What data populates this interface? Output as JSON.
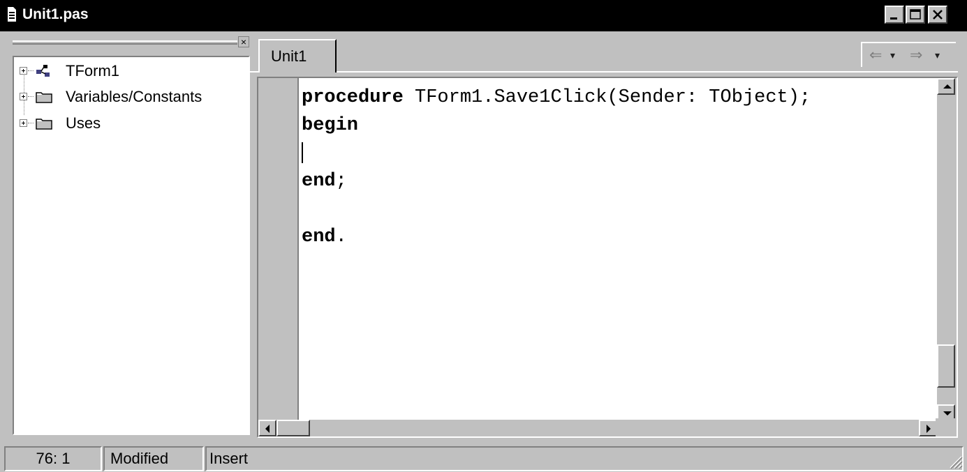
{
  "window": {
    "title": "Unit1.pas"
  },
  "explorer": {
    "close_glyph": "×",
    "items": [
      {
        "label": "TForm1",
        "icon": "form-class-icon"
      },
      {
        "label": "Variables/Constants",
        "icon": "folder-icon"
      },
      {
        "label": "Uses",
        "icon": "folder-icon"
      }
    ]
  },
  "editor": {
    "tabs": [
      {
        "label": "Unit1",
        "active": true
      }
    ],
    "nav": {
      "back": "⇐",
      "forward": "⇒",
      "dropdown": "▾"
    },
    "code": {
      "line1_kw": "procedure",
      "line1_rest": " TForm1.Save1Click(Sender: TObject);",
      "line2_kw": "begin",
      "line4_kw": "end",
      "line4_rest": ";",
      "line6_kw": "end",
      "line6_rest": "."
    }
  },
  "status": {
    "position": "76: 1",
    "modified": "Modified",
    "mode": "Insert"
  },
  "colors": {
    "title_bg": "#000000",
    "face": "#c0c0c0",
    "editor_bg": "#ffffff",
    "shadow": "#808080"
  }
}
